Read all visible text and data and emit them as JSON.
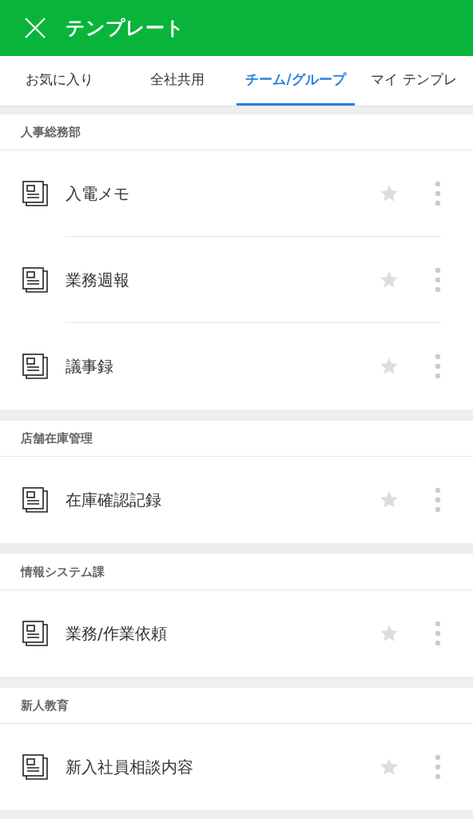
{
  "header": {
    "title": "テンプレート"
  },
  "tabs": [
    {
      "label": "お気に入り",
      "selected": false
    },
    {
      "label": "全社共用",
      "selected": false
    },
    {
      "label": "チーム/グループ",
      "selected": true
    },
    {
      "label": "マイ テンプレ",
      "selected": false
    }
  ],
  "sections": [
    {
      "title": "人事総務部",
      "items": [
        {
          "name": "入電メモ",
          "favorite": false
        },
        {
          "name": "業務週報",
          "favorite": false
        },
        {
          "name": "議事録",
          "favorite": false
        }
      ]
    },
    {
      "title": "店舗在庫管理",
      "items": [
        {
          "name": "在庫確認記録",
          "favorite": false
        }
      ]
    },
    {
      "title": "情報システム課",
      "items": [
        {
          "name": "業務/作業依頼",
          "favorite": false
        }
      ]
    },
    {
      "title": "新人教育",
      "items": [
        {
          "name": "新入社員相談内容",
          "favorite": false
        }
      ]
    }
  ]
}
